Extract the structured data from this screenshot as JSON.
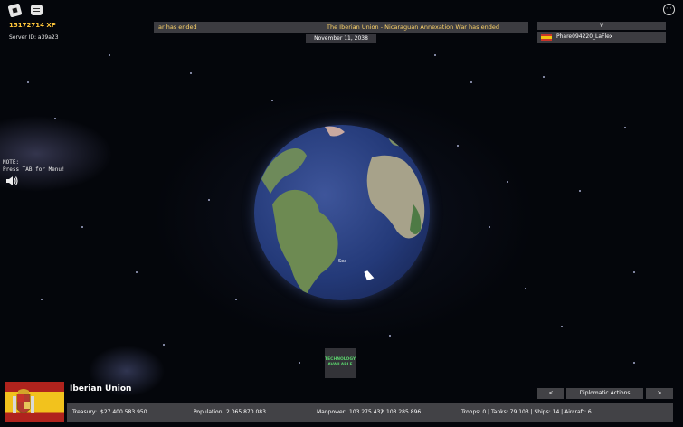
{
  "hud": {
    "xp": "15172714 XP",
    "server": "Server ID: a39a23",
    "note": "NOTE:\nPress TAB for Menu!"
  },
  "news": {
    "left": "ar has ended",
    "main": "The Iberian Union - Nicaraguan Annexation War has ended"
  },
  "date": "November 11, 2038",
  "players": {
    "toggle": "V",
    "list": [
      {
        "name": "Phare094220_LaFlex"
      }
    ]
  },
  "globe": {
    "label": "Sea"
  },
  "tech": {
    "line1": "TECHNOLOGY",
    "line2": "AVAILABLE"
  },
  "country": {
    "name": "Iberian Union",
    "treasury_label": "Treasury:",
    "treasury": "$27 400 583 950",
    "population_label": "Population:",
    "population": "2 065 870 083",
    "manpower_label": "Manpower:",
    "manpower_current": "103 275 432",
    "manpower_sep": "/",
    "manpower_max": "103 285 896",
    "military": "Troops: 0  |  Tanks: 79 103  |  Ships: 14  |  Aircraft: 6"
  },
  "diplomacy": {
    "prev": "<",
    "label": "Diplomatic Actions",
    "next": ">"
  },
  "icons": {
    "menu": "ellipsis-icon",
    "speaker": "speaker-icon",
    "roblox": "roblox-logo-icon",
    "chat": "chat-icon"
  }
}
